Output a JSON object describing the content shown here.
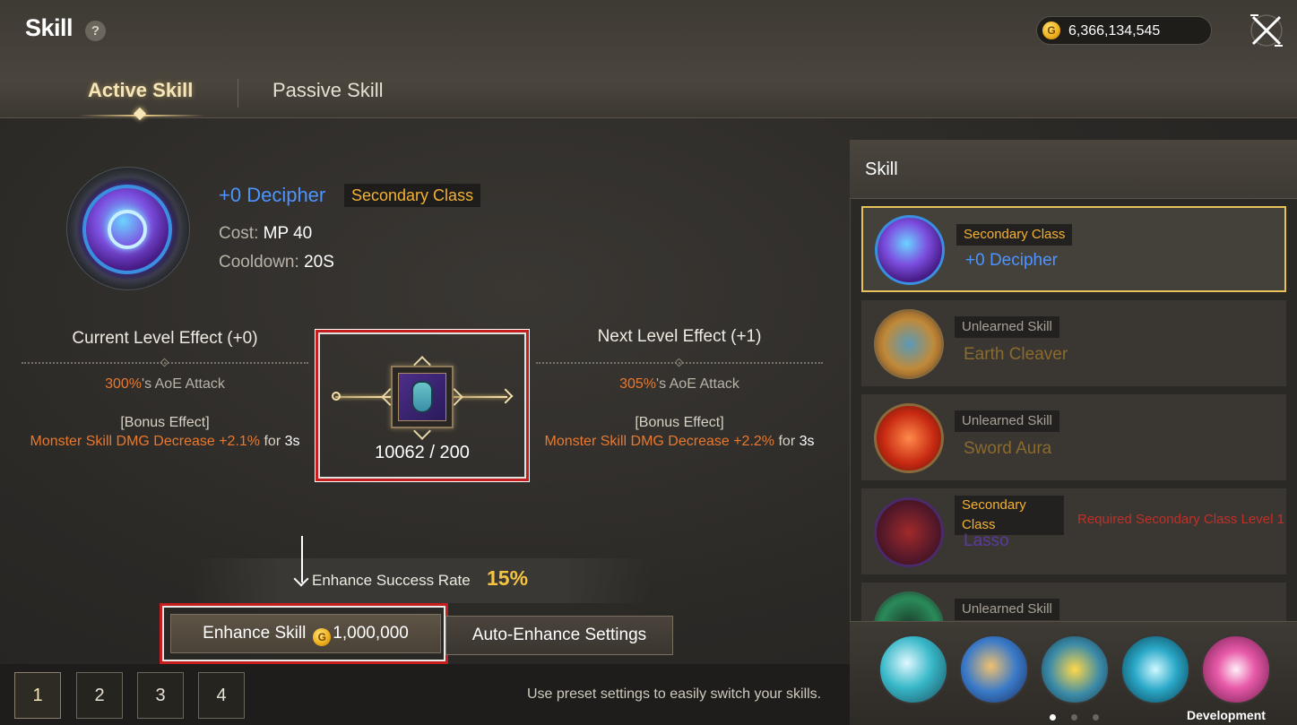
{
  "header": {
    "title": "Skill",
    "help_glyph": "?",
    "gold": "6,366,134,545",
    "coin_glyph": "G"
  },
  "tabs": {
    "active": "Active Skill",
    "passive": "Passive Skill"
  },
  "skill": {
    "name": "+0 Decipher",
    "class_tag": "Secondary Class",
    "cost_label": "Cost:",
    "cost_value": "MP 40",
    "cooldown_label": "Cooldown:",
    "cooldown_value": "20S"
  },
  "current_effect": {
    "title": "Current Level Effect (+0)",
    "pct": "300%",
    "main_suffix": "'s AoE Attack",
    "bonus_label": "[Bonus Effect]",
    "bonus_text": "Monster Skill DMG Decrease +2.1%",
    "for": "for",
    "duration": "3s"
  },
  "next_effect": {
    "title": "Next Level Effect (+1)",
    "pct": "305%",
    "main_suffix": "'s AoE Attack",
    "bonus_label": "[Bonus Effect]",
    "bonus_text": "Monster Skill DMG Decrease +2.2%",
    "for": "for",
    "duration": "3s"
  },
  "material": {
    "icon": "potion-icon",
    "count": "10062 / 200"
  },
  "enhance": {
    "rate_label": "Enhance Success Rate",
    "rate_value": "15%",
    "button_label": "Enhance Skill",
    "button_cost": "1,000,000",
    "auto_label": "Auto-Enhance Settings"
  },
  "presets": {
    "items": [
      "1",
      "2",
      "3",
      "4"
    ],
    "selected": "1",
    "hint": "Use preset settings to easily switch your skills."
  },
  "panel": {
    "title": "Skill",
    "slots": [
      {
        "tag": "Secondary Class",
        "name": "+0 Decipher",
        "name_color": "#4d94ff",
        "selected": true
      },
      {
        "tag": "Unlearned Skill",
        "name": "Earth Cleaver",
        "name_color": "#8a6a2e"
      },
      {
        "tag": "Unlearned Skill",
        "name": "Sword Aura",
        "name_color": "#8a6a2e"
      },
      {
        "tag": "Secondary Class",
        "name": "Lasso",
        "name_color": "#5a3aa0",
        "requirement": "Required Secondary Class Level 1"
      },
      {
        "tag": "Unlearned Skill",
        "name": ""
      }
    ]
  },
  "skill_bar": {
    "icons": [
      "slash-icon",
      "whirl-icon",
      "burst-icon",
      "fist-icon",
      "flare-icon"
    ],
    "pages": 3,
    "current_page": 1
  },
  "watermark": "Development Build",
  "colors": {
    "accent_gold": "#f5c441",
    "skill_name_blue": "#4d94ff",
    "highlight_orange": "#e8792f",
    "highlight_red": "#c41e1e"
  }
}
